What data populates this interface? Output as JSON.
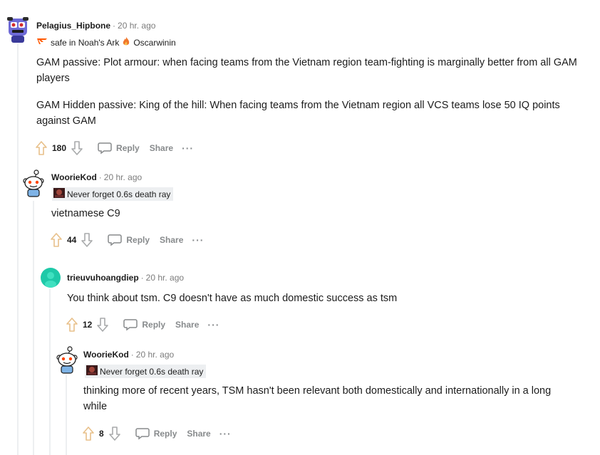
{
  "comments": [
    {
      "username": "Pelagius_Hipbone",
      "time": "20 hr. ago",
      "flair": {
        "part1": "safe in Noah's Ark",
        "part2": "Oscarwinin"
      },
      "paragraphs": [
        "GAM passive: Plot armour: when facing teams from the Vietnam region team-fighting is marginally better from all GAM players",
        "GAM Hidden passive: King of the hill: When facing teams from the Vietnam region all VCS teams lose 50 IQ points against GAM"
      ],
      "score": "180",
      "reply": "Reply",
      "share": "Share",
      "more": "···"
    },
    {
      "username": "WoorieKod",
      "time": "20 hr. ago",
      "flair": "Never forget 0.6s death ray",
      "paragraphs": [
        "vietnamese C9"
      ],
      "score": "44",
      "reply": "Reply",
      "share": "Share",
      "more": "···"
    },
    {
      "username": "trieuvuhoangdiep",
      "time": "20 hr. ago",
      "paragraphs": [
        "You think about tsm. C9 doesn't have as much domestic success as tsm"
      ],
      "score": "12",
      "reply": "Reply",
      "share": "Share",
      "more": "···"
    },
    {
      "username": "WoorieKod",
      "time": "20 hr. ago",
      "flair": "Never forget 0.6s death ray",
      "paragraphs": [
        "thinking more of recent years, TSM hasn't been relevant both domestically and internationally in a long while"
      ],
      "score": "8",
      "reply": "Reply",
      "share": "Share",
      "more": "···"
    }
  ],
  "colors": {
    "upvote": "#e8c08a",
    "thread_line": "#edeff1",
    "meta": "#7c7c7c",
    "avatar_teal": "#1ec9a8"
  }
}
